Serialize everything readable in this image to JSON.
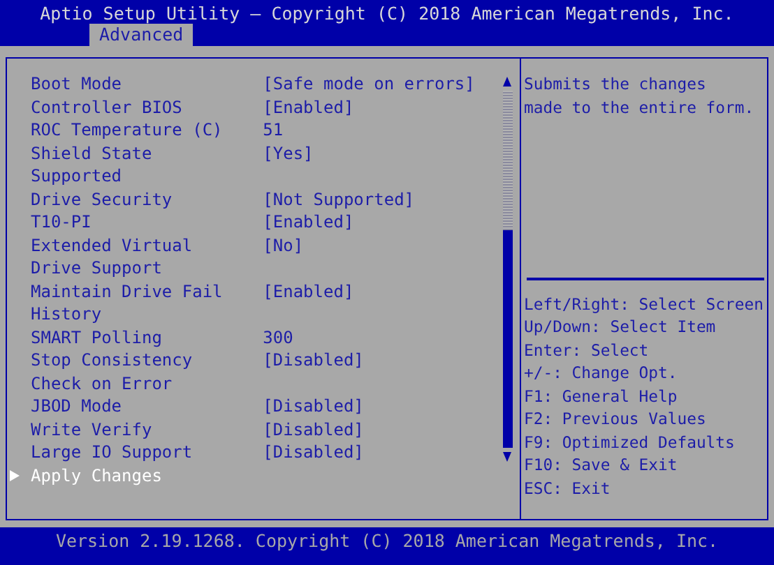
{
  "window": {
    "title": "Aptio Setup Utility – Copyright (C) 2018 American Megatrends, Inc."
  },
  "tabs": [
    {
      "label": "Advanced",
      "selected": true
    }
  ],
  "settings": [
    {
      "kind": "option",
      "label": "Boot Mode",
      "value": "[Safe mode on errors]",
      "selected": false
    },
    {
      "kind": "option",
      "label": "Controller BIOS",
      "value": "[Enabled]",
      "selected": false
    },
    {
      "kind": "info",
      "label": "ROC Temperature (C)",
      "value": "51",
      "selected": false
    },
    {
      "kind": "option",
      "label": "Shield State Supported",
      "value": "[Yes]",
      "selected": false
    },
    {
      "kind": "option",
      "label": "Drive Security",
      "value": "[Not Supported]",
      "selected": false
    },
    {
      "kind": "option",
      "label": "T10-PI",
      "value": "[Enabled]",
      "selected": false
    },
    {
      "kind": "option",
      "label": "Extended Virtual Drive Support",
      "value": "[No]",
      "selected": false
    },
    {
      "kind": "option",
      "label": "Maintain Drive Fail History",
      "value": "[Enabled]",
      "selected": false
    },
    {
      "kind": "info",
      "label": "SMART Polling",
      "value": "300",
      "selected": false
    },
    {
      "kind": "option",
      "label": "Stop Consistency Check on Error",
      "value": "[Disabled]",
      "selected": false
    },
    {
      "kind": "option",
      "label": "JBOD Mode",
      "value": "[Disabled]",
      "selected": false
    },
    {
      "kind": "option",
      "label": "Write Verify",
      "value": "[Disabled]",
      "selected": false
    },
    {
      "kind": "option",
      "label": "Large IO Support",
      "value": "[Disabled]",
      "selected": false
    },
    {
      "kind": "submenu",
      "label": "Apply Changes",
      "selected": true
    }
  ],
  "help": [
    "Submits the changes",
    "made to the entire form."
  ],
  "keys": [
    "Left/Right: Select Screen",
    "Up/Down: Select Item",
    "Enter: Select",
    "+/-: Change Opt.",
    "F1: General Help",
    "F2: Previous Values",
    "F9: Optimized Defaults",
    "F10: Save & Exit",
    "ESC: Exit"
  ],
  "status_bar": "Version 2.19.1268. Copyright (C) 2018 American Megatrends, Inc."
}
